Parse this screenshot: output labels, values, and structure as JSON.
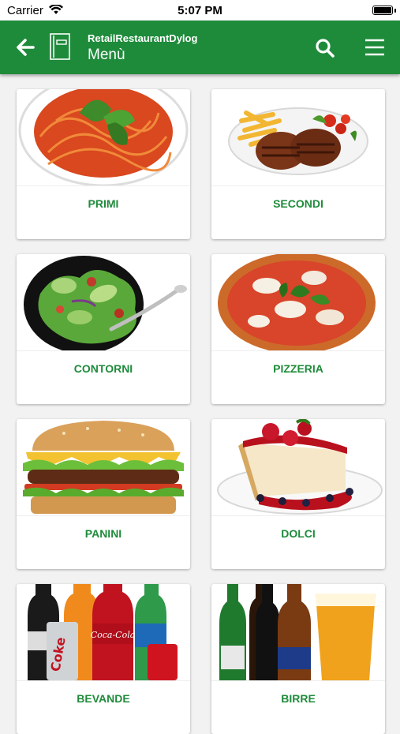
{
  "status_bar": {
    "carrier": "Carrier",
    "time": "5:07 PM"
  },
  "header": {
    "app_name": "RetailRestaurantDylog",
    "title": "Menù"
  },
  "categories": [
    {
      "label": "PRIMI",
      "icon": "pasta-image"
    },
    {
      "label": "SECONDI",
      "icon": "steak-image"
    },
    {
      "label": "CONTORNI",
      "icon": "salad-image"
    },
    {
      "label": "PIZZERIA",
      "icon": "pizza-image"
    },
    {
      "label": "PANINI",
      "icon": "burger-image"
    },
    {
      "label": "DOLCI",
      "icon": "cheesecake-image"
    },
    {
      "label": "BEVANDE",
      "icon": "soft-drinks-image"
    },
    {
      "label": "BIRRE",
      "icon": "beers-image"
    }
  ],
  "colors": {
    "primary": "#1e8b3a",
    "background": "#f2f2f2"
  }
}
